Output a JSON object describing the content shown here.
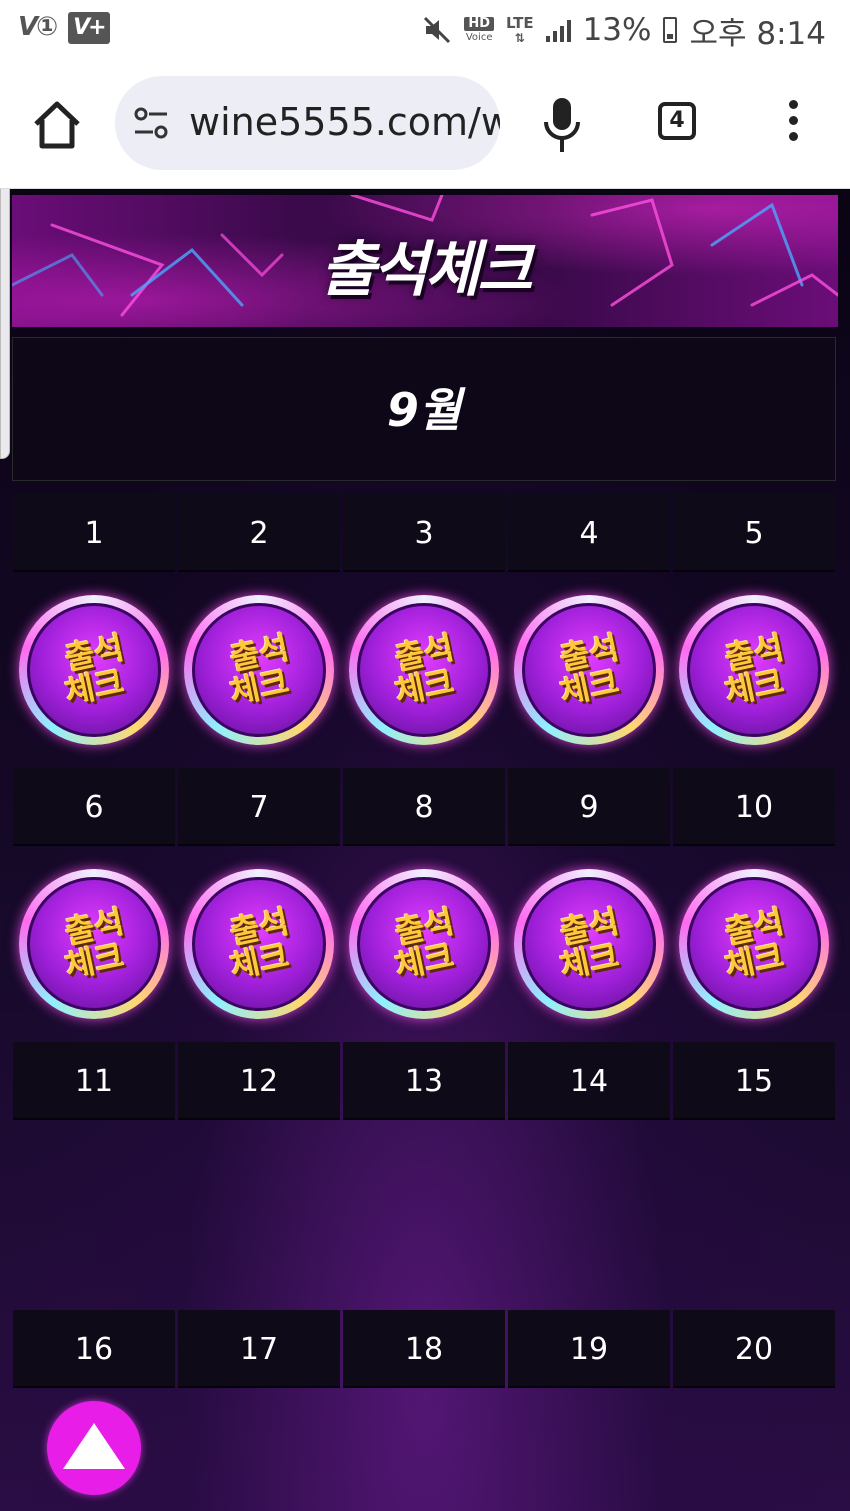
{
  "status_bar": {
    "left_icons": [
      "volte-1-icon",
      "volte-plus-icon"
    ],
    "right_icons": [
      "mute-icon",
      "hd-voice-icon",
      "lte-icon",
      "signal-icon",
      "battery-icon"
    ],
    "hd_label": "HD",
    "voice_label": "Voice",
    "lte_label": "LTE",
    "battery_percent": "13%",
    "time": "오후 8:14"
  },
  "browser": {
    "url": "wine5555.com/w",
    "tab_count": "4",
    "icons": [
      "home-icon",
      "site-settings-icon",
      "mic-icon",
      "tab-switcher-icon",
      "more-menu-icon"
    ]
  },
  "header": {
    "title": "출석체크",
    "accent_color": "#e81ee8"
  },
  "calendar": {
    "month": "9월",
    "weeks": [
      {
        "days": [
          "1",
          "2",
          "3",
          "4",
          "5"
        ],
        "stamped": [
          true,
          true,
          true,
          true,
          true
        ]
      },
      {
        "days": [
          "6",
          "7",
          "8",
          "9",
          "10"
        ],
        "stamped": [
          true,
          true,
          true,
          true,
          true
        ]
      },
      {
        "days": [
          "11",
          "12",
          "13",
          "14",
          "15"
        ],
        "stamped": [
          false,
          false,
          false,
          false,
          false
        ]
      },
      {
        "days": [
          "16",
          "17",
          "18",
          "19",
          "20"
        ],
        "stamped": [
          false,
          false,
          false,
          false,
          false
        ]
      }
    ],
    "stamp_text_line1": "출석",
    "stamp_text_line2": "체크"
  },
  "scroll_top": {
    "icon": "arrow-up-triangle-icon"
  }
}
